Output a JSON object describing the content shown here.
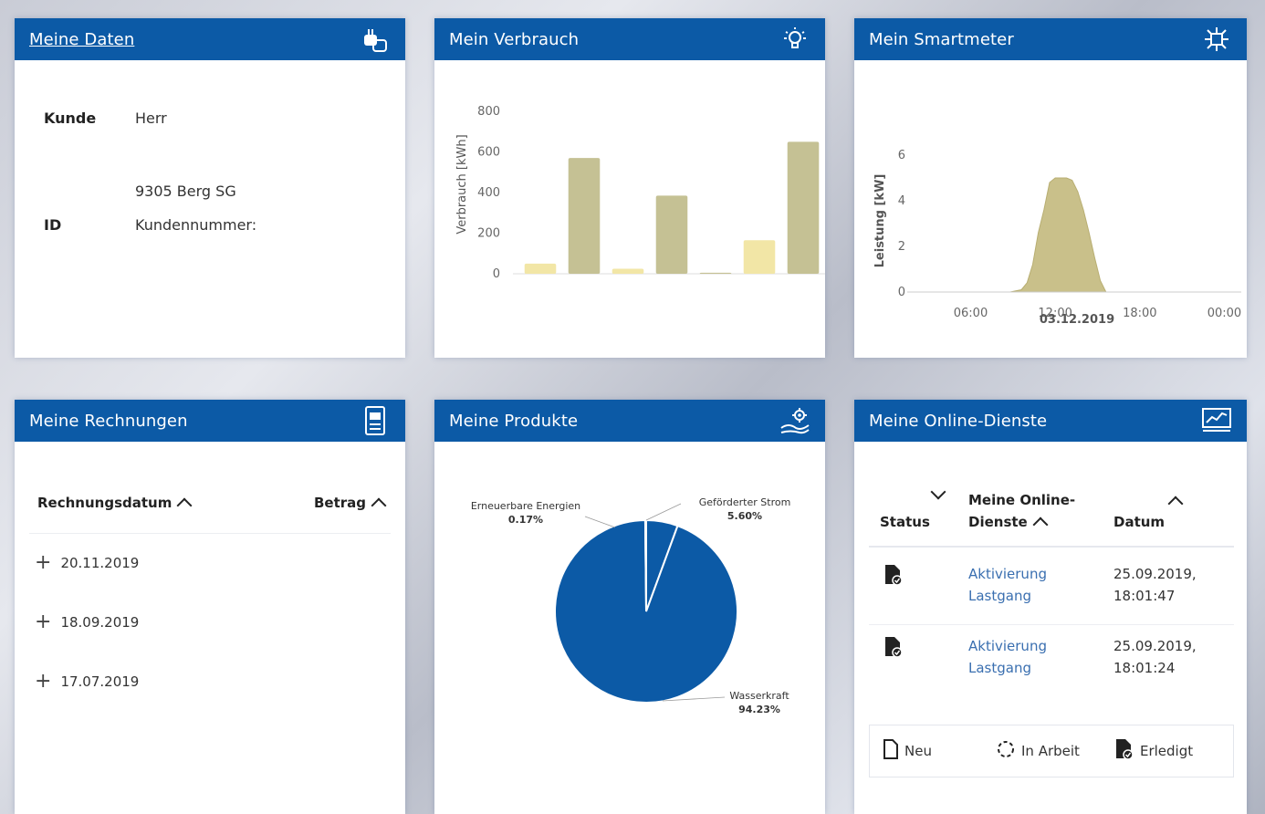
{
  "colors": {
    "header": "#0c5aa6",
    "bar_light": "#f2e6a6",
    "bar_dark": "#c5c194",
    "area": "#c9c08a",
    "pie_main": "#0c5aa6",
    "link": "#3a6fb0"
  },
  "daten": {
    "title": "Meine Daten",
    "icon": "plug-icon",
    "kunde_label": "Kunde",
    "kunde_value": "Herr",
    "address": "9305 Berg SG",
    "id_label": "ID",
    "id_value": "Kundennummer:"
  },
  "verbrauch": {
    "title": "Mein Verbrauch",
    "icon": "lightbulb-icon"
  },
  "smartmeter": {
    "title": "Mein Smartmeter",
    "icon": "smartmeter-icon",
    "date": "03.12.2019"
  },
  "rechnungen": {
    "title": "Meine Rechnungen",
    "icon": "invoice-icon",
    "col_date": "Rechnungsdatum",
    "col_amount": "Betrag",
    "rows": [
      {
        "date": "20.11.2019"
      },
      {
        "date": "18.09.2019"
      },
      {
        "date": "17.07.2019"
      }
    ]
  },
  "produkte": {
    "title": "Meine Produkte",
    "icon": "hand-gear-icon"
  },
  "online": {
    "title": "Meine Online-Dienste",
    "icon": "monitor-chart-icon",
    "col_status": "Status",
    "col_dienste_1": "Meine Online-",
    "col_dienste_2": "Dienste",
    "col_datum": "Datum",
    "rows": [
      {
        "dienst_1": "Aktivierung",
        "dienst_2": "Lastgang",
        "datum_1": "25.09.2019,",
        "datum_2": "18:01:47"
      },
      {
        "dienst_1": "Aktivierung",
        "dienst_2": "Lastgang",
        "datum_1": "25.09.2019,",
        "datum_2": "18:01:24"
      }
    ],
    "legend_new": "Neu",
    "legend_progress": "In Arbeit",
    "legend_done": "Erledigt"
  },
  "chart_data": [
    {
      "type": "bar",
      "ylabel": "Verbrauch [kWh]",
      "ylim": [
        0,
        800
      ],
      "yticks": [
        "0",
        "200",
        "400",
        "600",
        "800"
      ],
      "series": [
        {
          "values": [
            50,
            570,
            25,
            385,
            5,
            165,
            650
          ]
        }
      ],
      "bar_styles": [
        "light",
        "dark",
        "light",
        "dark",
        "dark",
        "light",
        "dark"
      ]
    },
    {
      "type": "area",
      "ylabel": "Leistung [kW]",
      "xlabel": "03.12.2019",
      "ylim": [
        0,
        6
      ],
      "yticks": [
        "0",
        "2",
        "4",
        "6"
      ],
      "xticks": [
        "06:00",
        "12:00",
        "18:00",
        "00:00"
      ],
      "x_hours": [
        0,
        8.8,
        9.6,
        10.0,
        10.4,
        10.8,
        11.2,
        11.6,
        12.0,
        12.4,
        12.8,
        13.2,
        13.6,
        14.0,
        14.4,
        14.8,
        15.2,
        15.6,
        24
      ],
      "y": [
        0,
        0,
        0.1,
        0.4,
        1.2,
        2.6,
        3.6,
        4.8,
        5.0,
        5.0,
        5.0,
        4.9,
        4.4,
        3.6,
        2.6,
        1.5,
        0.5,
        0,
        0
      ]
    },
    {
      "type": "pie",
      "slices": [
        {
          "name": "Wasserkraft",
          "pct_label": "94.23%",
          "value": 94.23
        },
        {
          "name": "Erneuerbare Energien",
          "pct_label": "0.17%",
          "value": 0.17
        },
        {
          "name": "Geförderter Strom",
          "pct_label": "5.60%",
          "value": 5.6
        }
      ]
    }
  ]
}
